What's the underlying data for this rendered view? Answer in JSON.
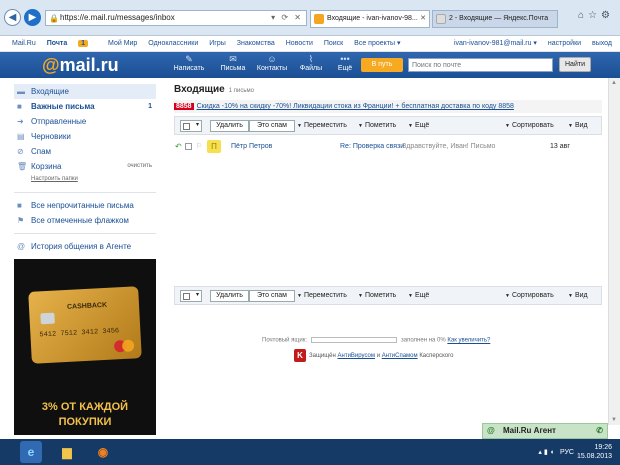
{
  "browser": {
    "url": "https://e.mail.ru/messages/inbox",
    "tabs": [
      {
        "label": "Входящие - ivan-ivanov-98..."
      },
      {
        "label": "2 - Входящие — Яндекс.Почта"
      }
    ]
  },
  "portal": {
    "links": [
      "Mail.Ru",
      "Почта",
      "Мой Мир",
      "Одноклассники",
      "Игры",
      "Знакомства",
      "Новости",
      "Поиск",
      "Все проекты ▾"
    ],
    "mail_counter": "1",
    "user": "ivan-ivanov-981@mail.ru ▾",
    "settings": "настройки",
    "logout": "выход"
  },
  "header": {
    "logo_at": "@",
    "logo_text": "mail.ru",
    "buttons": {
      "write": "Написать",
      "letters": "Письма",
      "contacts": "Контакты",
      "files": "Файлы",
      "more": "Ещё"
    },
    "go_button": "В путь",
    "search_placeholder": "Поиск по почте",
    "find_button": "Найти"
  },
  "sidebar": {
    "folders": [
      {
        "label": "Входящие"
      },
      {
        "label": "Важные письма",
        "count": "1"
      },
      {
        "label": "Отправленные"
      },
      {
        "label": "Черновики"
      },
      {
        "label": "Спам"
      },
      {
        "label": "Корзина",
        "action": "очистить"
      }
    ],
    "settings_link": "Настроить папки",
    "filters": [
      {
        "label": "Все непрочитанные письма"
      },
      {
        "label": "Все отмеченные флажком"
      }
    ],
    "agent_history": "История общения в Агенте"
  },
  "ad": {
    "card_brand": "CASHBACK",
    "card_number": "5412 7512 3412 3456",
    "text_line1": "3% ОТ КАЖДОЙ",
    "text_line2": "ПОКУПКИ"
  },
  "content": {
    "title": "Входящие",
    "count": "1 письмо",
    "promo_number": "8858",
    "promo_text": "Скидка -10% на скидку -70%! Ликвидации стока из Франции! + бесплатная доставка по коду 8858",
    "toolbar": {
      "delete": "Удалить",
      "spam": "Это спам",
      "move": "Переместить",
      "mark": "Пометить",
      "more": "Ещё",
      "sort": "Сортировать",
      "view": "Вид"
    },
    "message": {
      "avatar": "П",
      "from": "Пётр Петров",
      "subject": "Re: Проверка связи",
      "snippet": "Здравствуйте, Иван! Письмо",
      "date": "13 авг"
    }
  },
  "footer": {
    "quota_label": "Почтовый ящик:",
    "quota_text": "заполнен на 0%",
    "quota_link": "Как увеличить?",
    "av_prefix": "Защищён",
    "av_link1": "АнтиВирусом",
    "av_and": "и",
    "av_link2": "АнтиСпамом",
    "av_suffix": "Касперского"
  },
  "agent": {
    "label": "Mail.Ru Агент"
  },
  "taskbar": {
    "language": "РУС",
    "time": "19:26",
    "date": "15.08.2013"
  },
  "colors": {
    "header_blue": "#1b4f95",
    "accent_orange": "#f7a922",
    "link_blue": "#1a4f95"
  }
}
